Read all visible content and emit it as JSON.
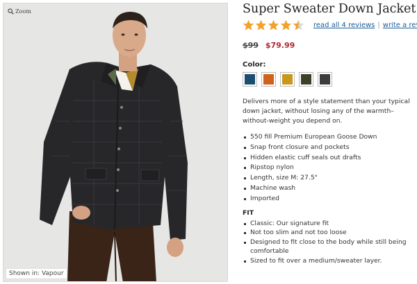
{
  "image": {
    "zoom_label": "Zoom",
    "shown_in": "Shown in: Vapour"
  },
  "product": {
    "title": "Super Sweater Down Jacket",
    "rating": 4.5,
    "rating_max": 5,
    "reviews_link": "read all 4 reviews",
    "separator": "|",
    "write_review_link": "write a review",
    "old_price": "$99",
    "new_price": "$79.99",
    "color_label": "Color:",
    "swatches": [
      {
        "name": "navy",
        "color": "#1d4e70"
      },
      {
        "name": "orange",
        "color": "#d0621b"
      },
      {
        "name": "mustard",
        "color": "#c9961e"
      },
      {
        "name": "olive",
        "color": "#3b4128"
      },
      {
        "name": "charcoal",
        "color": "#3c3c3c"
      }
    ],
    "description": "Delivers more of a style statement than your typical down jacket, without losing any of the warmth–without-weight you depend on.",
    "features": [
      "550 fill Premium European Goose Down",
      "Snap front closure and pockets",
      "Hidden elastic cuff seals out drafts",
      "Ripstop nylon",
      "Length, size M: 27.5\"",
      "Machine wash",
      "Imported"
    ],
    "fit_heading": "FIT",
    "fit_items": [
      "Classic: Our signature fit",
      "Not too slim and not too loose",
      "Designed to fit close to the body while still being comfortable",
      "Sized to fit over a medium/sweater layer."
    ]
  },
  "colors": {
    "star": "#f2a12a",
    "link": "#1a5a9a",
    "sale_price": "#b3262d"
  }
}
